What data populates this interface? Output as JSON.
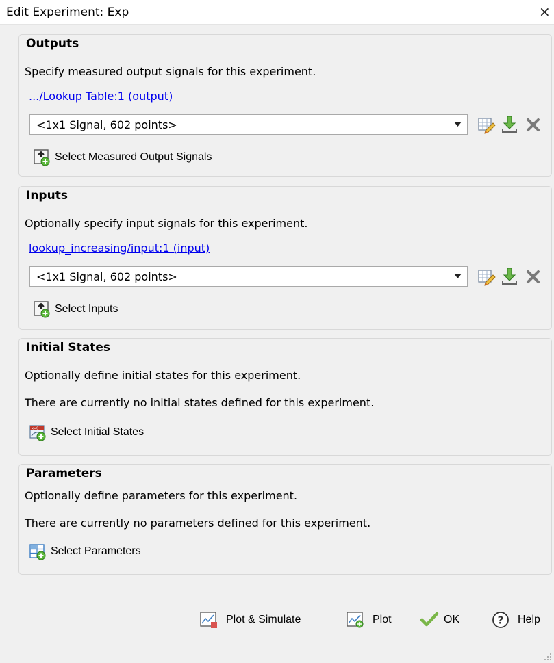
{
  "window": {
    "title": "Edit Experiment: Exp",
    "close_label": "×"
  },
  "outputs": {
    "heading": "Outputs",
    "description": "Specify measured output signals for this experiment.",
    "signal_link": ".../Lookup Table:1 (output)",
    "signal_value": "<1x1 Signal, 602 points>",
    "select_label": "Select Measured Output Signals"
  },
  "inputs": {
    "heading": "Inputs",
    "description": "Optionally specify input signals for this experiment.",
    "signal_link": "lookup_increasing/input:1 (input)",
    "signal_value": "<1x1 Signal, 602 points>",
    "select_label": "Select Inputs"
  },
  "initial_states": {
    "heading": "Initial States",
    "description": "Optionally define initial states for this experiment.",
    "status": "There are currently no initial states defined for this experiment.",
    "select_label": "Select Initial States"
  },
  "parameters": {
    "heading": "Parameters",
    "description": "Optionally define parameters for this experiment.",
    "status": "There are currently no parameters defined for this experiment.",
    "select_label": "Select Parameters"
  },
  "footer": {
    "plot_simulate_label": "Plot & Simulate",
    "plot_label": "Plot",
    "ok_label": "OK",
    "help_label": "Help"
  },
  "colors": {
    "link": "#0000ee",
    "ok_check": "#7ab648",
    "delete_x": "#7a7a7a"
  }
}
